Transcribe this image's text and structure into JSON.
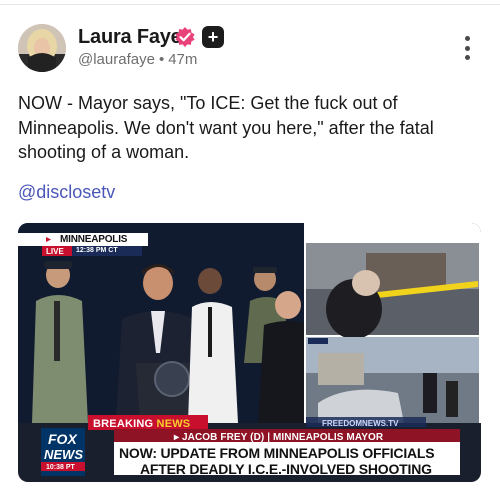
{
  "post": {
    "author_name": "Laura Faye",
    "handle": "@laurafaye",
    "separator": "•",
    "time_ago": "47m",
    "plus_badge": "+",
    "text": "NOW - Mayor says, \"To ICE: Get the fuck out of Minneapolis. We don't want you here,\" after the fatal shooting of a woman.",
    "mention": "@disclosetv",
    "verified_color": "#e9417a"
  },
  "media": {
    "location": "MINNEAPOLIS",
    "live_label": "LIVE",
    "live_time": "12:38 PM CT",
    "breaking_prefix": "BREAKING",
    "breaking_suffix": "NEWS",
    "source_credit": "FREEDOMNEWS.TV",
    "speaker_line": "▸ JACOB FREY (D) | MINNEAPOLIS MAYOR",
    "headline_1": "NOW: UPDATE FROM MINNEAPOLIS OFFICIALS",
    "headline_2": "AFTER DEADLY I.C.E.-INVOLVED SHOOTING",
    "network_1": "FOX",
    "network_2": "NEWS",
    "network_time": "10:38 PT"
  }
}
